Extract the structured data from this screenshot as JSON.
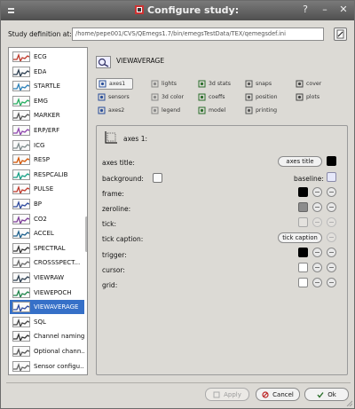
{
  "window": {
    "title": "Configure study:",
    "help_glyph": "?",
    "minimize_glyph": "–",
    "close_glyph": "✕"
  },
  "study": {
    "label": "Study definition at:",
    "path": "/home/pepe001/CVS/QEmegs1.7/bin/emegsTestData/TEX/qemegsdef.ini"
  },
  "left_list": {
    "selected": "VIEWAVERAGE",
    "items": [
      {
        "label": "ECG",
        "icon": "ecg-icon"
      },
      {
        "label": "EDA",
        "icon": "eda-icon"
      },
      {
        "label": "STARTLE",
        "icon": "startle-icon"
      },
      {
        "label": "EMG",
        "icon": "emg-icon"
      },
      {
        "label": "MARKER",
        "icon": "marker-icon"
      },
      {
        "label": "ERP/ERF",
        "icon": "erp-icon"
      },
      {
        "label": "ICG",
        "icon": "icg-icon"
      },
      {
        "label": "RESP",
        "icon": "resp-icon"
      },
      {
        "label": "RESPCALIB",
        "icon": "respcalib-icon"
      },
      {
        "label": "PULSE",
        "icon": "pulse-icon"
      },
      {
        "label": "BP",
        "icon": "bp-icon"
      },
      {
        "label": "CO2",
        "icon": "co2-icon"
      },
      {
        "label": "ACCEL",
        "icon": "accel-icon"
      },
      {
        "label": "SPECTRAL",
        "icon": "spectral-icon"
      },
      {
        "label": "CROSSSPECT...",
        "icon": "crossspect-icon"
      },
      {
        "label": "VIEWRAW",
        "icon": "viewraw-icon"
      },
      {
        "label": "VIEWEPOCH",
        "icon": "viewepoch-icon"
      },
      {
        "label": "VIEWAVERAGE",
        "icon": "viewaverage-icon"
      },
      {
        "label": "SQL",
        "icon": "sql-icon"
      },
      {
        "label": "Channel naming",
        "icon": "channel-naming-icon"
      },
      {
        "label": "Optional chann...",
        "icon": "optional-channels-icon"
      },
      {
        "label": "Sensor configu...",
        "icon": "sensor-config-icon"
      }
    ]
  },
  "right": {
    "header": "VIEWAVERAGE",
    "tabs": [
      {
        "label": "axes1",
        "icon": "axes-icon",
        "active": true
      },
      {
        "label": "lights",
        "icon": "lights-icon"
      },
      {
        "label": "3d stats",
        "icon": "stats3d-icon"
      },
      {
        "label": "snaps",
        "icon": "snaps-icon"
      },
      {
        "label": "cover",
        "icon": "cover-icon"
      },
      {
        "label": "sensors",
        "icon": "sensors-icon"
      },
      {
        "label": "3d color",
        "icon": "color3d-icon"
      },
      {
        "label": "coeffs",
        "icon": "coeffs-icon"
      },
      {
        "label": "position",
        "icon": "position-icon"
      },
      {
        "label": "plots",
        "icon": "plots-icon"
      },
      {
        "label": "axes2",
        "icon": "axes2-icon"
      },
      {
        "label": "legend",
        "icon": "legend-icon"
      },
      {
        "label": "model",
        "icon": "model-icon"
      },
      {
        "label": "printing",
        "icon": "printing-icon"
      }
    ],
    "panel": {
      "title": "axes 1:",
      "rows": {
        "axes_title": "axes title:",
        "axes_title_btn": "axes title",
        "background": "background:",
        "baseline": "baseline:",
        "frame": "frame:",
        "zeroline": "zeroline:",
        "tick": "tick:",
        "tick_caption": "tick caption:",
        "tick_caption_btn": "tick caption",
        "trigger": "trigger:",
        "cursor": "cursor:",
        "grid": "grid:"
      }
    }
  },
  "buttons": {
    "apply": "Apply",
    "cancel": "Cancel",
    "ok": "Ok"
  },
  "colors": {
    "selection": "#3670c8",
    "window_bg": "#dcdad5",
    "titlebar": "#5e5e5e"
  }
}
